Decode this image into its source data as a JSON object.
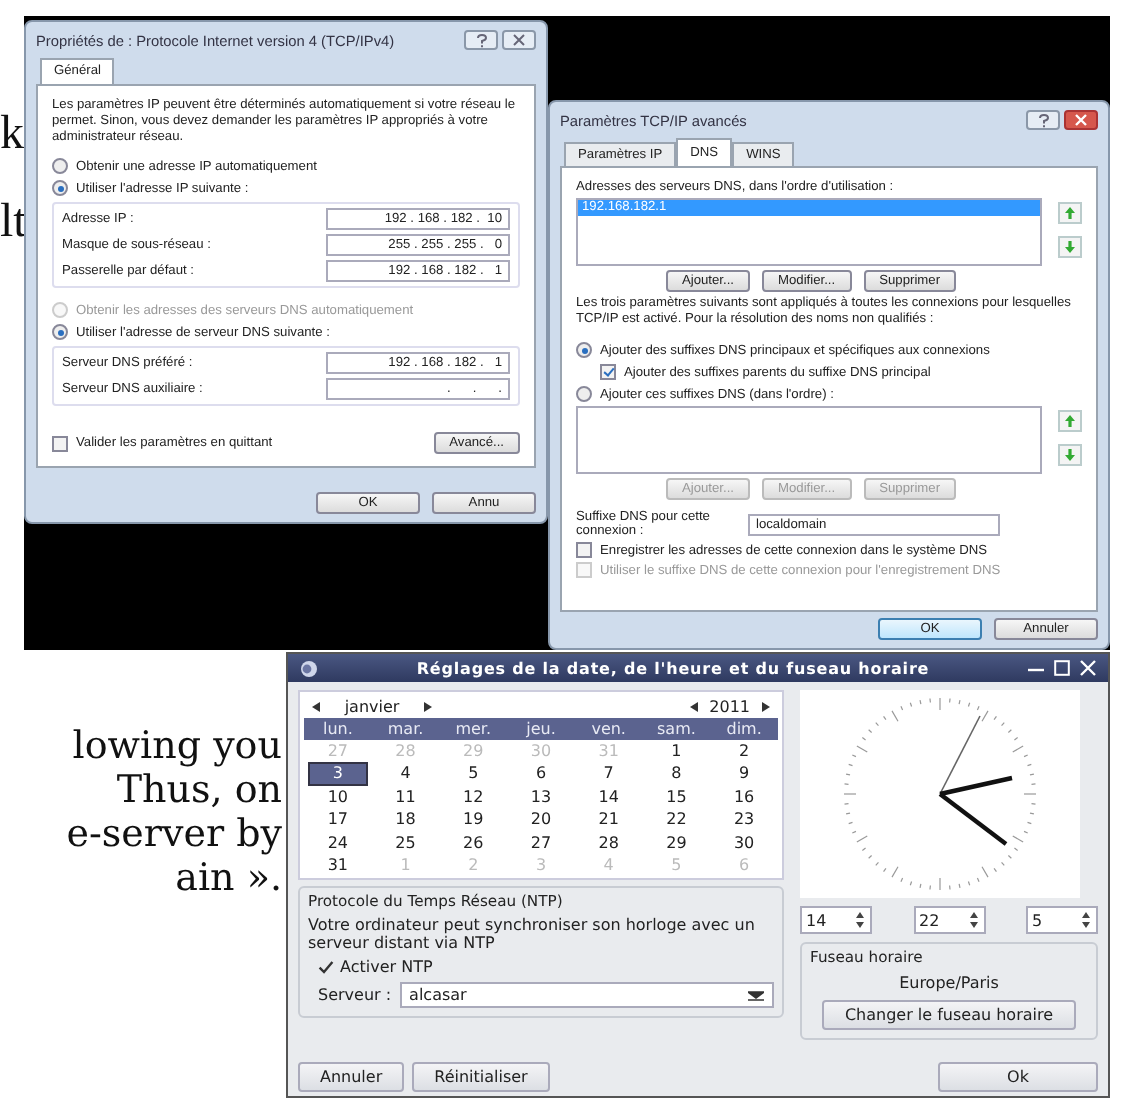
{
  "margin_text_top": [
    "k",
    "lt"
  ],
  "margin_text_bottom": [
    "lowing you",
    "Thus, on",
    "e-server by",
    "ain »."
  ],
  "ipv4_dialog": {
    "title": "Propriétés de : Protocole Internet version 4 (TCP/IPv4)",
    "tabs": [
      {
        "label": "Général",
        "selected": true
      }
    ],
    "intro": "Les paramètres IP peuvent être déterminés automatiquement si votre réseau le permet. Sinon, vous devez demander les paramètres IP appropriés à votre administrateur réseau.",
    "ip_options": [
      {
        "label": "Obtenir une adresse IP automatiquement",
        "selected": false,
        "disabled": false
      },
      {
        "label": "Utiliser l'adresse IP suivante :",
        "selected": true,
        "disabled": false
      }
    ],
    "ip_fields": [
      {
        "label": "Adresse IP :",
        "value": "192 . 168 . 182 .  10"
      },
      {
        "label": "Masque de sous-réseau :",
        "value": "255 . 255 . 255 .   0"
      },
      {
        "label": "Passerelle par défaut :",
        "value": "192 . 168 . 182 .   1"
      }
    ],
    "dns_options": [
      {
        "label": "Obtenir les adresses des serveurs DNS automatiquement",
        "selected": false,
        "disabled": true
      },
      {
        "label": "Utiliser l'adresse de serveur DNS suivante :",
        "selected": true,
        "disabled": false
      }
    ],
    "dns_fields": [
      {
        "label": "Serveur DNS préféré :",
        "value": "192 . 168 . 182 .   1"
      },
      {
        "label": "Serveur DNS auxiliaire :",
        "value": ".      .      ."
      }
    ],
    "validate": {
      "label": "Valider les paramètres en quittant",
      "checked": false
    },
    "advanced_button": "Avancé...",
    "buttons": [
      "OK",
      "Annu"
    ]
  },
  "advanced_dialog": {
    "title": "Paramètres TCP/IP avancés",
    "tabs": [
      {
        "label": "Paramètres IP",
        "selected": false
      },
      {
        "label": "DNS",
        "selected": true
      },
      {
        "label": "WINS",
        "selected": false
      }
    ],
    "servers_label": "Adresses des serveurs DNS, dans l'ordre d'utilisation :",
    "servers": [
      {
        "value": "192.168.182.1",
        "selected": true
      }
    ],
    "server_buttons": [
      {
        "label": "Ajouter...",
        "disabled": false
      },
      {
        "label": "Modifier...",
        "disabled": false
      },
      {
        "label": "Supprimer",
        "disabled": false
      }
    ],
    "note": "Les trois paramètres suivants sont appliqués à toutes les connexions pour lesquelles TCP/IP est activé. Pour la résolution des noms non qualifiés :",
    "suffix_options": [
      {
        "kind": "radio",
        "label": "Ajouter des suffixes DNS principaux et spécifiques aux connexions",
        "selected": true
      },
      {
        "kind": "checkbox",
        "label": "Ajouter des suffixes parents du suffixe DNS principal",
        "checked": true
      },
      {
        "kind": "radio",
        "label": "Ajouter ces suffixes DNS (dans l'ordre) :",
        "selected": false
      }
    ],
    "suffix_buttons": [
      {
        "label": "Ajouter...",
        "disabled": true
      },
      {
        "label": "Modifier...",
        "disabled": true
      },
      {
        "label": "Supprimer",
        "disabled": true
      }
    ],
    "suffix_label": "Suffixe DNS pour cette connexion :",
    "suffix_value": "localdomain",
    "register_options": [
      {
        "label": "Enregistrer les adresses de cette connexion dans le système DNS",
        "checked": false,
        "disabled": false
      },
      {
        "label": "Utiliser le suffixe DNS de cette connexion pour l'enregistrement DNS",
        "checked": false,
        "disabled": true
      }
    ],
    "buttons": [
      {
        "label": "OK",
        "selected": true
      },
      {
        "label": "Annuler",
        "selected": false
      }
    ]
  },
  "date_dialog": {
    "title": "Réglages de la date, de l'heure et du fuseau horaire",
    "month": "janvier",
    "year": "2011",
    "weekdays": [
      "lun.",
      "mar.",
      "mer.",
      "jeu.",
      "ven.",
      "sam.",
      "dim."
    ],
    "days": [
      {
        "label": "27",
        "outside": true,
        "selected": false
      },
      {
        "label": "28",
        "outside": true,
        "selected": false
      },
      {
        "label": "29",
        "outside": true,
        "selected": false
      },
      {
        "label": "30",
        "outside": true,
        "selected": false
      },
      {
        "label": "31",
        "outside": true,
        "selected": false
      },
      {
        "label": "1",
        "outside": false,
        "selected": false
      },
      {
        "label": "2",
        "outside": false,
        "selected": false
      },
      {
        "label": "3",
        "outside": false,
        "selected": true
      },
      {
        "label": "4",
        "outside": false,
        "selected": false
      },
      {
        "label": "5",
        "outside": false,
        "selected": false
      },
      {
        "label": "6",
        "outside": false,
        "selected": false
      },
      {
        "label": "7",
        "outside": false,
        "selected": false
      },
      {
        "label": "8",
        "outside": false,
        "selected": false
      },
      {
        "label": "9",
        "outside": false,
        "selected": false
      },
      {
        "label": "10",
        "outside": false,
        "selected": false
      },
      {
        "label": "11",
        "outside": false,
        "selected": false
      },
      {
        "label": "12",
        "outside": false,
        "selected": false
      },
      {
        "label": "13",
        "outside": false,
        "selected": false
      },
      {
        "label": "14",
        "outside": false,
        "selected": false
      },
      {
        "label": "15",
        "outside": false,
        "selected": false
      },
      {
        "label": "16",
        "outside": false,
        "selected": false
      },
      {
        "label": "17",
        "outside": false,
        "selected": false
      },
      {
        "label": "18",
        "outside": false,
        "selected": false
      },
      {
        "label": "19",
        "outside": false,
        "selected": false
      },
      {
        "label": "20",
        "outside": false,
        "selected": false
      },
      {
        "label": "21",
        "outside": false,
        "selected": false
      },
      {
        "label": "22",
        "outside": false,
        "selected": false
      },
      {
        "label": "23",
        "outside": false,
        "selected": false
      },
      {
        "label": "24",
        "outside": false,
        "selected": false
      },
      {
        "label": "25",
        "outside": false,
        "selected": false
      },
      {
        "label": "26",
        "outside": false,
        "selected": false
      },
      {
        "label": "27",
        "outside": false,
        "selected": false
      },
      {
        "label": "28",
        "outside": false,
        "selected": false
      },
      {
        "label": "29",
        "outside": false,
        "selected": false
      },
      {
        "label": "30",
        "outside": false,
        "selected": false
      },
      {
        "label": "31",
        "outside": false,
        "selected": false
      },
      {
        "label": "1",
        "outside": true,
        "selected": false
      },
      {
        "label": "2",
        "outside": true,
        "selected": false
      },
      {
        "label": "3",
        "outside": true,
        "selected": false
      },
      {
        "label": "4",
        "outside": true,
        "selected": false
      },
      {
        "label": "5",
        "outside": true,
        "selected": false
      },
      {
        "label": "6",
        "outside": true,
        "selected": false
      }
    ],
    "ntp": {
      "title": "Protocole du Temps Réseau (NTP)",
      "description": "Votre ordinateur peut synchroniser son horloge avec un serveur distant via NTP",
      "enable": {
        "label": "Activer NTP",
        "checked": true
      },
      "server_label": "Serveur :",
      "server_value": "alcasar"
    },
    "time": [
      "14",
      "22",
      "5"
    ],
    "timezone": {
      "title": "Fuseau horaire",
      "value": "Europe/Paris",
      "button": "Changer le fuseau horaire"
    },
    "buttons": [
      "Annuler",
      "Réinitialiser",
      "Ok"
    ]
  }
}
